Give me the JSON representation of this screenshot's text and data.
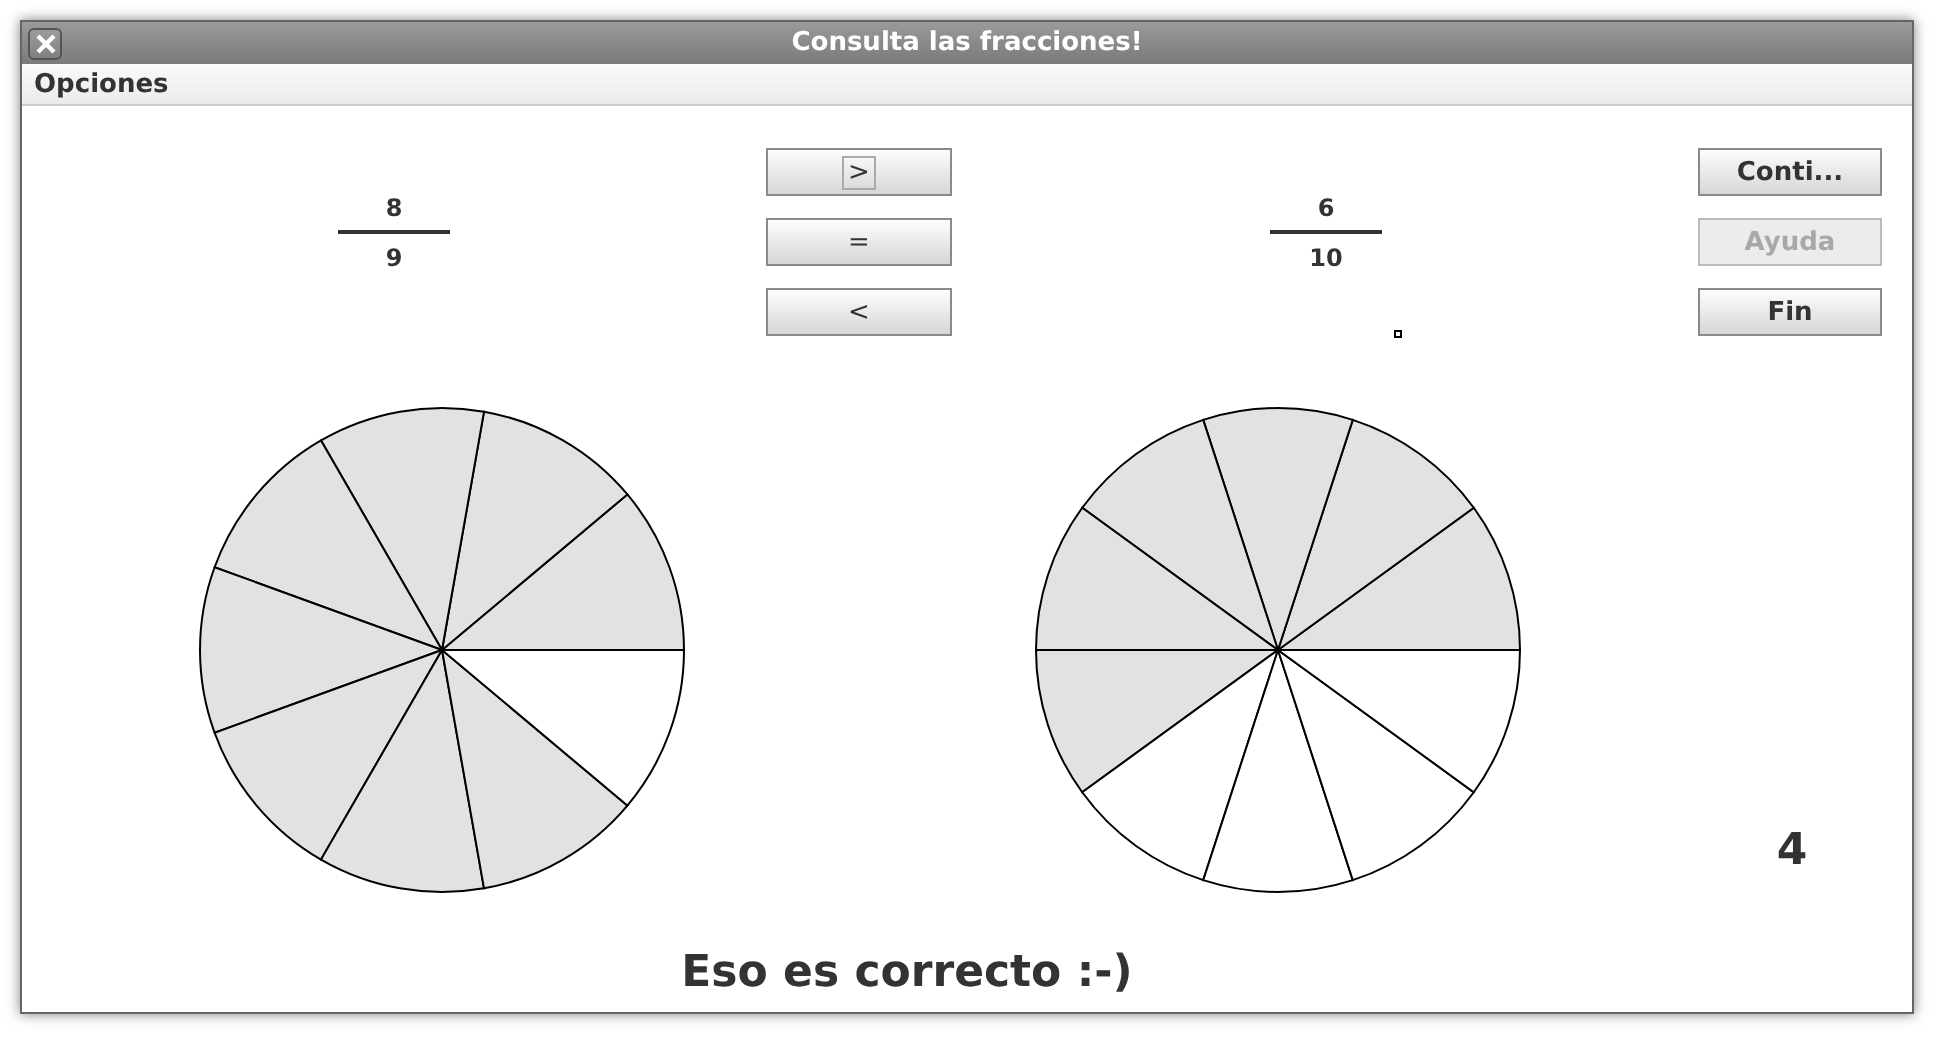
{
  "window": {
    "title": "Consulta las fracciones!"
  },
  "menu": [
    "Opciones"
  ],
  "left_fraction": {
    "numerator": "8",
    "denominator": "9",
    "slices": [
      {
        "shaded": true
      },
      {
        "shaded": true
      },
      {
        "shaded": true
      },
      {
        "shaded": true
      },
      {
        "shaded": true
      },
      {
        "shaded": true
      },
      {
        "shaded": true
      },
      {
        "shaded": true
      },
      {
        "shaded": false
      }
    ]
  },
  "compare_buttons": [
    {
      "label": ">",
      "focused": true
    },
    {
      "label": "=",
      "focused": false
    },
    {
      "label": "<",
      "focused": false
    }
  ],
  "right_fraction": {
    "numerator": "6",
    "denominator": "10",
    "slices": [
      {
        "shaded": true
      },
      {
        "shaded": true
      },
      {
        "shaded": true
      },
      {
        "shaded": true
      },
      {
        "shaded": true
      },
      {
        "shaded": true
      },
      {
        "shaded": false
      },
      {
        "shaded": false
      },
      {
        "shaded": false
      },
      {
        "shaded": false
      }
    ]
  },
  "action_buttons": [
    {
      "label": "Conti...",
      "disabled": false
    },
    {
      "label": "Ayuda",
      "disabled": true
    },
    {
      "label": "Fin",
      "disabled": false
    }
  ],
  "score": "4",
  "message": "Eso es correcto :-)"
}
